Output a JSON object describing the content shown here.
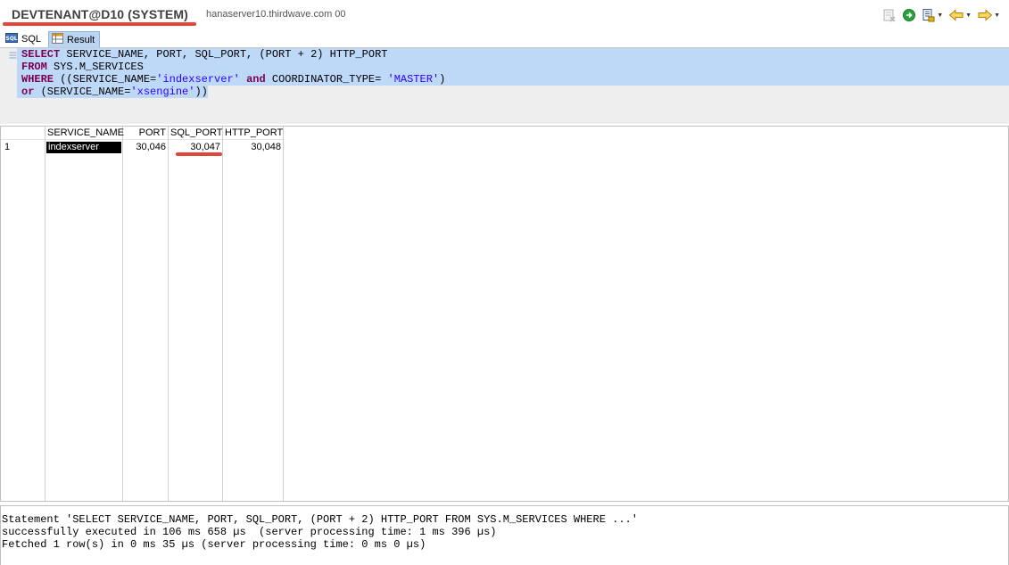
{
  "header": {
    "connection": "DEVTENANT@D10 (SYSTEM)",
    "host": "hanaserver10.thirdwave.com 00"
  },
  "toolbar": {
    "icons": [
      "terminate-icon",
      "run-icon",
      "explain-icon",
      "back-icon",
      "forward-icon"
    ]
  },
  "tabs": [
    {
      "label": "SQL",
      "icon": "sql-icon",
      "active": false
    },
    {
      "label": "Result",
      "icon": "grid-icon",
      "active": true
    }
  ],
  "editor": {
    "lines": [
      [
        {
          "t": "SELECT",
          "k": "kw"
        },
        {
          "t": " SERVICE_NAME, PORT, SQL_PORT, (PORT + 2) HTTP_PORT",
          "k": "plain"
        }
      ],
      [
        {
          "t": "FROM",
          "k": "kw"
        },
        {
          "t": " SYS.M_SERVICES",
          "k": "plain"
        }
      ],
      [
        {
          "t": "WHERE",
          "k": "kw"
        },
        {
          "t": " ((SERVICE_NAME=",
          "k": "plain"
        },
        {
          "t": "'indexserver'",
          "k": "str"
        },
        {
          "t": " ",
          "k": "plain"
        },
        {
          "t": "and",
          "k": "kw"
        },
        {
          "t": " COORDINATOR_TYPE= ",
          "k": "plain"
        },
        {
          "t": "'MASTER'",
          "k": "str"
        },
        {
          "t": ")",
          "k": "plain"
        }
      ],
      [
        {
          "t": "or",
          "k": "kw"
        },
        {
          "t": " (SERVICE_NAME=",
          "k": "plain"
        },
        {
          "t": "'xsengine'",
          "k": "str"
        },
        {
          "t": "))",
          "k": "plain"
        }
      ]
    ]
  },
  "result": {
    "columns": [
      "SERVICE_NAME",
      "PORT",
      "SQL_PORT",
      "HTTP_PORT"
    ],
    "rows": [
      {
        "num": "1",
        "service_name": "indexserver",
        "port": "30,046",
        "sql_port": "30,047",
        "http_port": "30,048"
      }
    ]
  },
  "status": {
    "line1": "Statement 'SELECT SERVICE_NAME, PORT, SQL_PORT, (PORT + 2) HTTP_PORT FROM SYS.M_SERVICES WHERE ...'",
    "line2": "successfully executed in 106 ms 658 µs  (server processing time: 1 ms 396 µs)",
    "line3": "Fetched 1 row(s) in 0 ms 35 µs (server processing time: 0 ms 0 µs)"
  },
  "colors": {
    "highlight": "#e0463a",
    "selection": "#bed8f8",
    "keyword": "#7b0052",
    "string": "#2a00ff"
  }
}
